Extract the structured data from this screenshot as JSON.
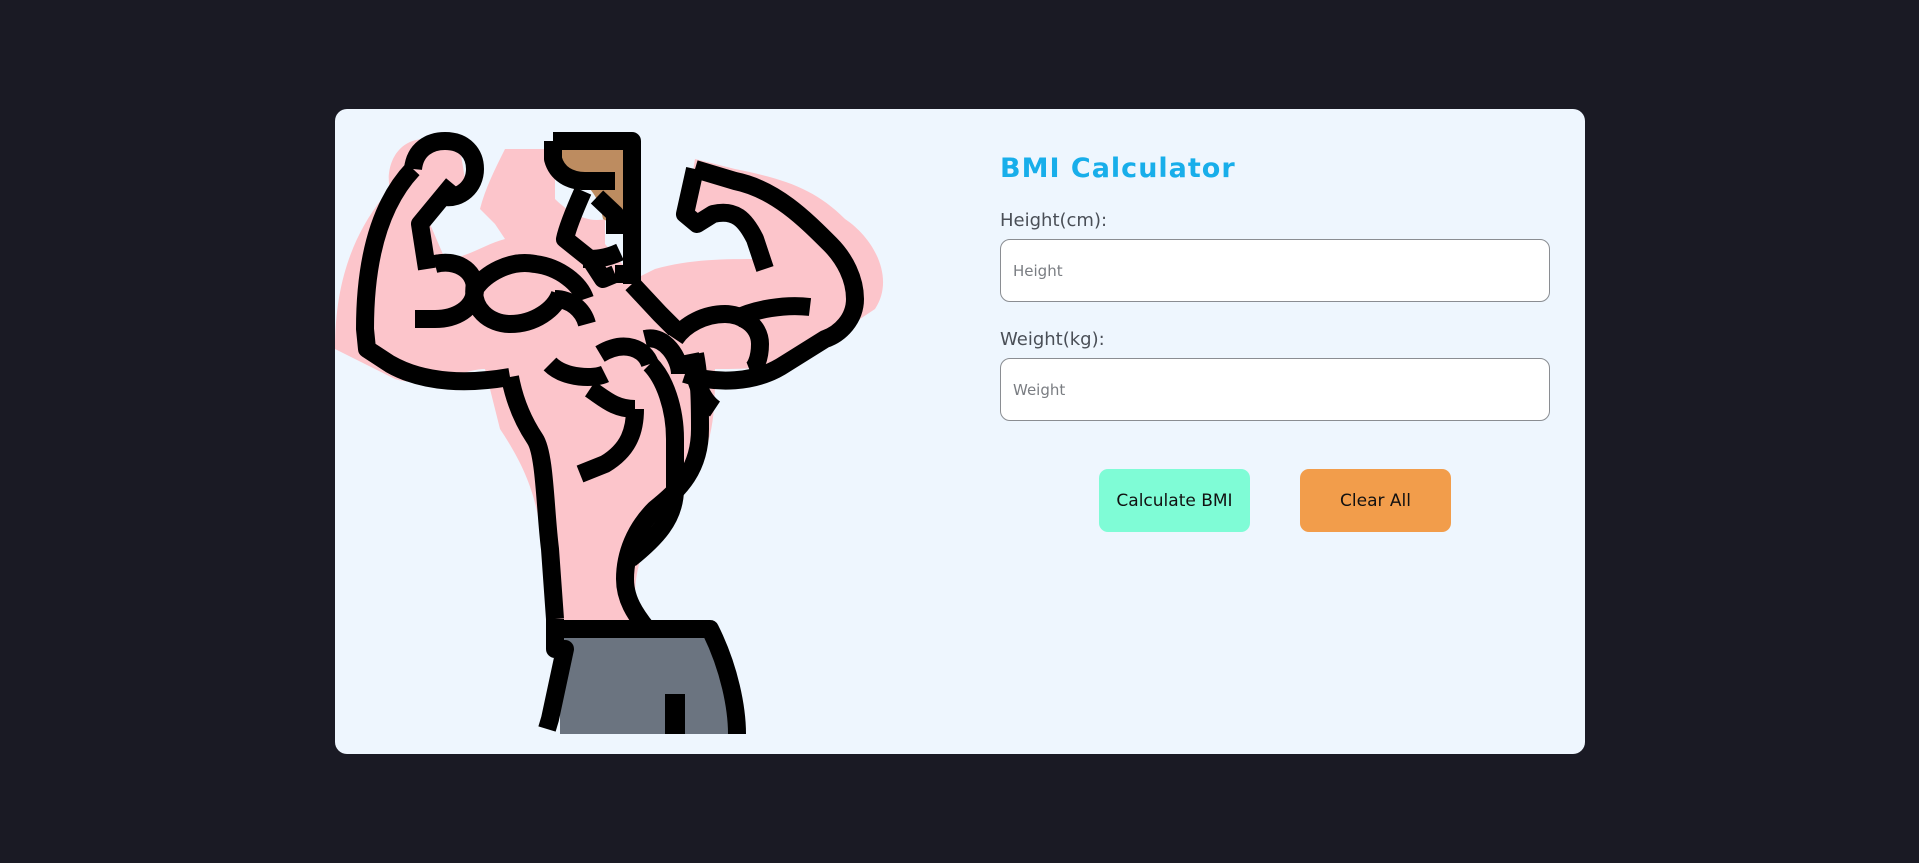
{
  "app": {
    "title": "BMI Calculator"
  },
  "illustration": {
    "icon": "flexing-man-icon",
    "colors": {
      "skin": "#fcc5cb",
      "hair": "#bd8c60",
      "pants": "#6b7480",
      "outline": "#000000"
    }
  },
  "form": {
    "height_label": "Height(cm):",
    "height_placeholder": "Height",
    "height_value": "",
    "weight_label": "Weight(kg):",
    "weight_placeholder": "Weight",
    "weight_value": ""
  },
  "buttons": {
    "calculate_label": "Calculate BMI",
    "clear_label": "Clear All"
  },
  "colors": {
    "page_background": "#1a1a24",
    "card_background": "#eef6fe",
    "title": "#18aeea",
    "calculate_button": "#7ffcd6",
    "clear_button": "#f29d4b"
  }
}
